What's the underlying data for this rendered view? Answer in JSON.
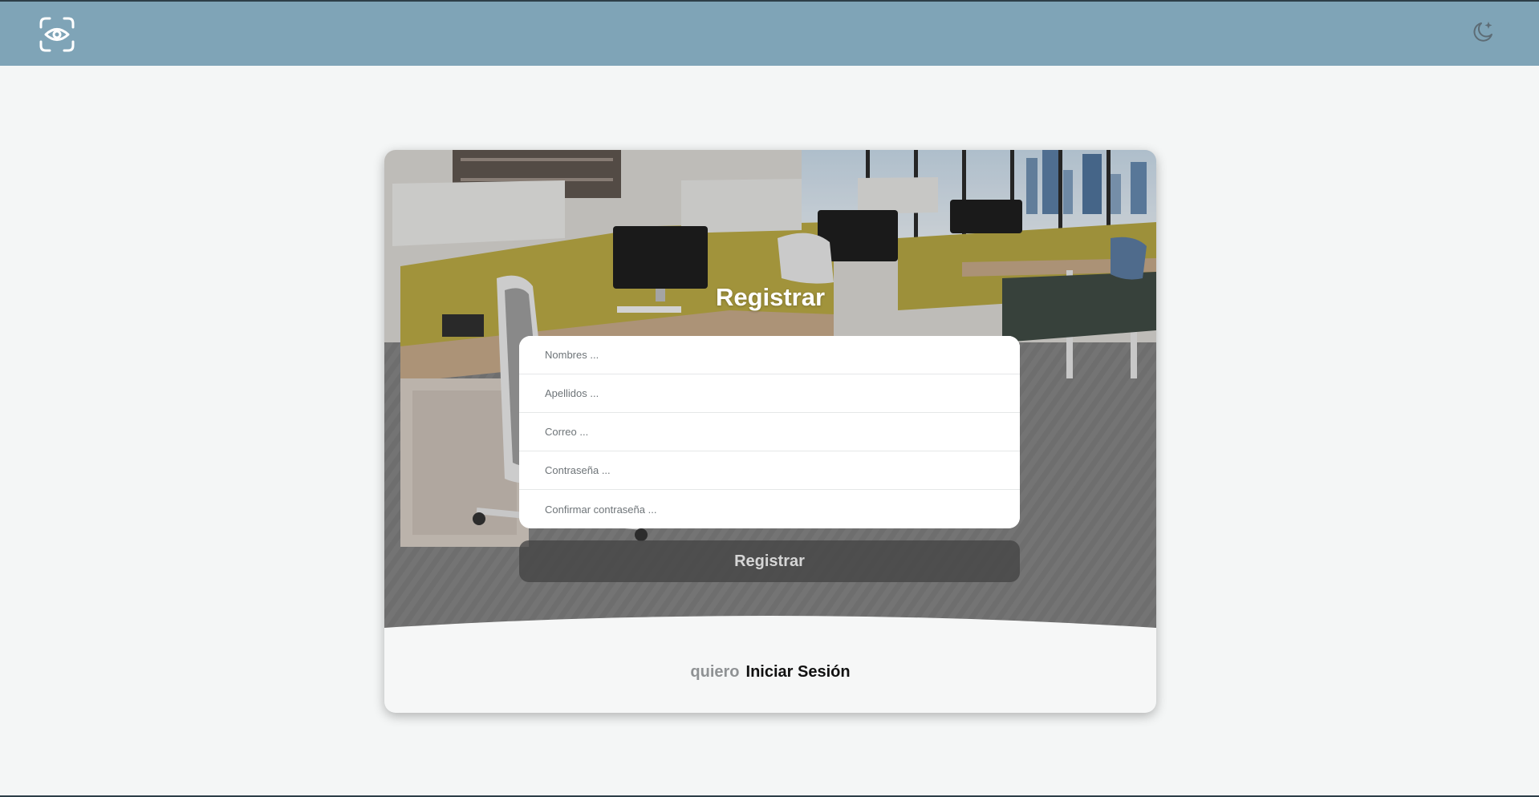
{
  "header": {
    "logo_icon": "eye-scan-icon",
    "theme_toggle_icon": "moon-star-icon",
    "background": "#7fa4b7"
  },
  "register": {
    "title": "Registrar",
    "fields": [
      {
        "name": "nombres",
        "placeholder": "Nombres ..."
      },
      {
        "name": "apellidos",
        "placeholder": "Apellidos ..."
      },
      {
        "name": "correo",
        "placeholder": "Correo ..."
      },
      {
        "name": "contrasena",
        "placeholder": "Contraseña ..."
      },
      {
        "name": "confirmar",
        "placeholder": "Confirmar contraseña ..."
      }
    ],
    "submit_label": "Registrar"
  },
  "switch": {
    "prefix": "quiero",
    "link_label": "Iniciar Sesión"
  }
}
